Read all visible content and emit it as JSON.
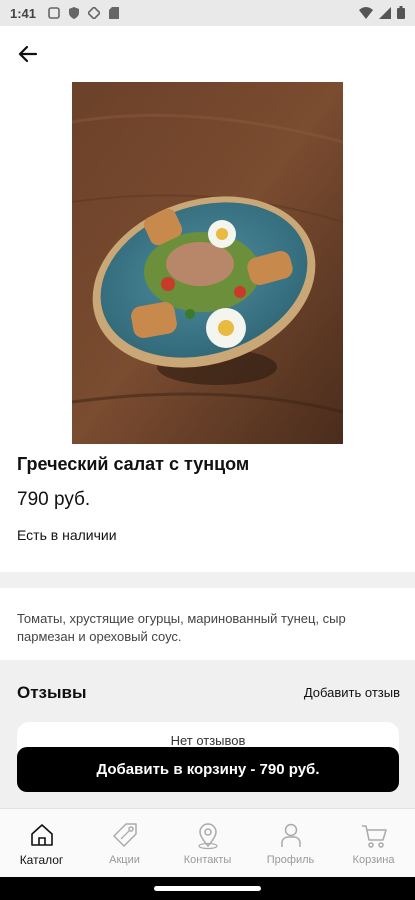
{
  "status_bar": {
    "time": "1:41"
  },
  "product": {
    "title": "Греческий салат с тунцом",
    "price": "790 руб.",
    "availability": "Есть в наличии",
    "description": "Томаты, хрустящие огурцы, маринованный тунец, сыр пармезан и ореховый соус."
  },
  "reviews": {
    "title": "Отзывы",
    "add_label": "Добавить отзыв",
    "empty_label": "Нет отзывов"
  },
  "cart_button": {
    "label": "Добавить в корзину - 790 руб."
  },
  "tabs": [
    {
      "label": "Каталог",
      "icon": "home-icon",
      "active": true
    },
    {
      "label": "Акции",
      "icon": "tag-icon",
      "active": false
    },
    {
      "label": "Контакты",
      "icon": "location-pin-icon",
      "active": false
    },
    {
      "label": "Профиль",
      "icon": "profile-icon",
      "active": false
    },
    {
      "label": "Корзина",
      "icon": "cart-icon",
      "active": false
    }
  ],
  "colors": {
    "primary": "#000000",
    "background": "#f0f0f0",
    "card": "#ffffff",
    "inactive": "#999999"
  }
}
